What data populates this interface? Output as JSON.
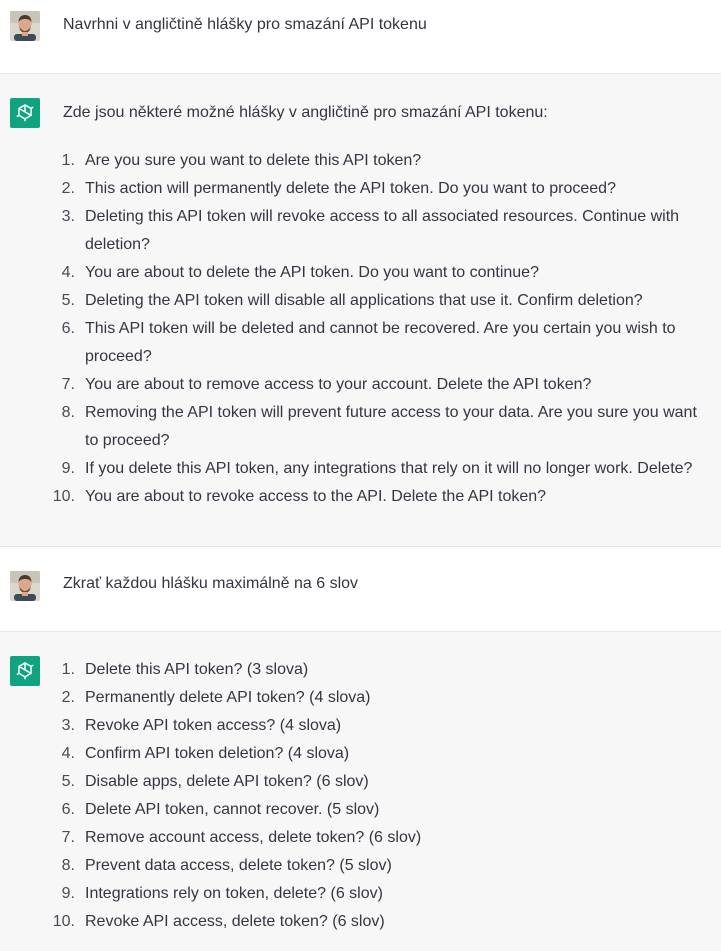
{
  "conversation": [
    {
      "role": "user",
      "text": "Navrhni v angličtině hlášky pro smazání API tokenu"
    },
    {
      "role": "assistant",
      "intro": "Zde jsou některé možné hlášky v angličtině pro smazání API tokenu:",
      "items": [
        {
          "num": "1.",
          "text": "Are you sure you want to delete this API token?"
        },
        {
          "num": "2.",
          "text": "This action will permanently delete the API token. Do you want to proceed?"
        },
        {
          "num": "3.",
          "text": "Deleting this API token will revoke access to all associated resources. Continue with deletion?"
        },
        {
          "num": "4.",
          "text": "You are about to delete the API token. Do you want to continue?"
        },
        {
          "num": "5.",
          "text": "Deleting the API token will disable all applications that use it. Confirm deletion?"
        },
        {
          "num": "6.",
          "text": "This API token will be deleted and cannot be recovered. Are you certain you wish to proceed?"
        },
        {
          "num": "7.",
          "text": "You are about to remove access to your account. Delete the API token?"
        },
        {
          "num": "8.",
          "text": "Removing the API token will prevent future access to your data. Are you sure you want to proceed?"
        },
        {
          "num": "9.",
          "text": "If you delete this API token, any integrations that rely on it will no longer work. Delete?"
        },
        {
          "num": "10.",
          "text": "You are about to revoke access to the API. Delete the API token?"
        }
      ]
    },
    {
      "role": "user",
      "text": "Zkrať každou hlášku maximálně na 6 slov"
    },
    {
      "role": "assistant",
      "intro": "",
      "items": [
        {
          "num": "1.",
          "text": "Delete this API token? (3 slova)"
        },
        {
          "num": "2.",
          "text": "Permanently delete API token? (4 slova)"
        },
        {
          "num": "3.",
          "text": "Revoke API token access? (4 slova)"
        },
        {
          "num": "4.",
          "text": "Confirm API token deletion? (4 slova)"
        },
        {
          "num": "5.",
          "text": "Disable apps, delete API token? (6 slov)"
        },
        {
          "num": "6.",
          "text": "Delete API token, cannot recover. (5 slov)"
        },
        {
          "num": "7.",
          "text": "Remove account access, delete token? (6 slov)"
        },
        {
          "num": "8.",
          "text": "Prevent data access, delete token? (5 slov)"
        },
        {
          "num": "9.",
          "text": "Integrations rely on token, delete? (6 slov)"
        },
        {
          "num": "10.",
          "text": "Revoke API access, delete token? (6 slov)"
        }
      ]
    }
  ],
  "colors": {
    "assistant_bg": "#f7f7f8",
    "user_bg": "#ffffff",
    "bot_avatar": "#10a37f",
    "text": "#343541"
  },
  "icons": {
    "user_avatar": "user-avatar-icon",
    "assistant_avatar": "openai-logo-icon"
  }
}
